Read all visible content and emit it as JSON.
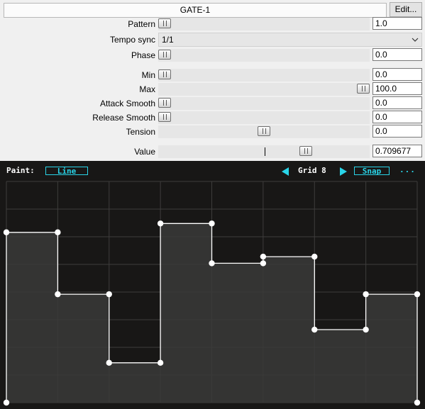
{
  "header": {
    "title": "GATE-1",
    "edit_label": "Edit..."
  },
  "params": [
    {
      "id": "pattern",
      "label": "Pattern",
      "value": "1.0",
      "fraction": 0.0
    },
    {
      "id": "tempo-sync",
      "label": "Tempo sync",
      "value": "1/1",
      "type": "select"
    },
    {
      "id": "phase",
      "label": "Phase",
      "value": "0.0",
      "fraction": 0.0
    },
    {
      "id": "min",
      "label": "Min",
      "value": "0.0",
      "fraction": 0.0
    },
    {
      "id": "max",
      "label": "Max",
      "value": "100.0",
      "fraction": 1.0
    },
    {
      "id": "attack-smooth",
      "label": "Attack Smooth",
      "value": "0.0",
      "fraction": 0.0
    },
    {
      "id": "release-smooth",
      "label": "Release Smooth",
      "value": "0.0",
      "fraction": 0.0
    },
    {
      "id": "tension",
      "label": "Tension",
      "value": "0.0",
      "fraction": 0.5
    },
    {
      "id": "value",
      "label": "Value",
      "value": "0.709677",
      "fraction": 0.709677
    }
  ],
  "toolbar": {
    "paint_label": "Paint:",
    "paint_mode": "Line",
    "grid_label": "Grid 8",
    "snap_label": "Snap",
    "more_label": "..."
  },
  "colors": {
    "accent": "#29d4e8",
    "editor_bg": "#181716",
    "fill": "#3a3938",
    "line": "#ffffff",
    "grid": "#3e3d3c"
  },
  "envelope": {
    "grid_divisions": 8,
    "points": [
      [
        0.0,
        0.0
      ],
      [
        0.0,
        0.77
      ],
      [
        0.125,
        0.77
      ],
      [
        0.125,
        0.49
      ],
      [
        0.25,
        0.49
      ],
      [
        0.25,
        0.18
      ],
      [
        0.375,
        0.18
      ],
      [
        0.375,
        0.81
      ],
      [
        0.5,
        0.81
      ],
      [
        0.5,
        0.63
      ],
      [
        0.625,
        0.63
      ],
      [
        0.625,
        0.66
      ],
      [
        0.75,
        0.66
      ],
      [
        0.75,
        0.33
      ],
      [
        0.875,
        0.33
      ],
      [
        0.875,
        0.49
      ],
      [
        1.0,
        0.49
      ],
      [
        1.0,
        0.0
      ]
    ]
  }
}
